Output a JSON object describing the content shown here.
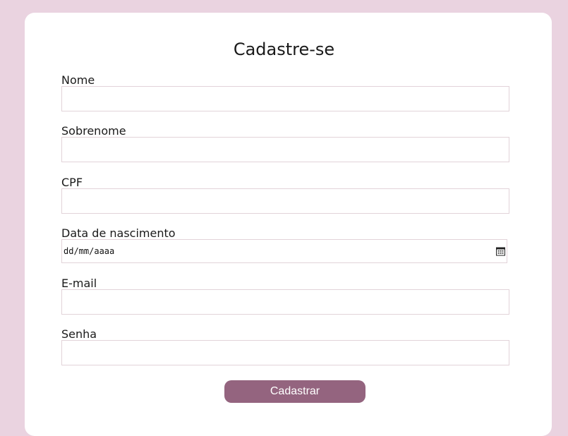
{
  "form": {
    "title": "Cadastre-se",
    "fields": [
      {
        "label": "Nome",
        "value": ""
      },
      {
        "label": "Sobrenome",
        "value": ""
      },
      {
        "label": "CPF",
        "value": ""
      },
      {
        "label": "Data de nascimento",
        "value": "dd/mm/aaaa"
      },
      {
        "label": "E-mail",
        "value": ""
      },
      {
        "label": "Senha",
        "value": ""
      }
    ],
    "submit_label": "Cadastrar"
  },
  "colors": {
    "page_background": "#ead3e0",
    "card_background": "#ffffff",
    "button_background": "#94647f",
    "input_border": "#e2d3d9"
  },
  "icons": {
    "date_picker": "calendar-icon"
  }
}
